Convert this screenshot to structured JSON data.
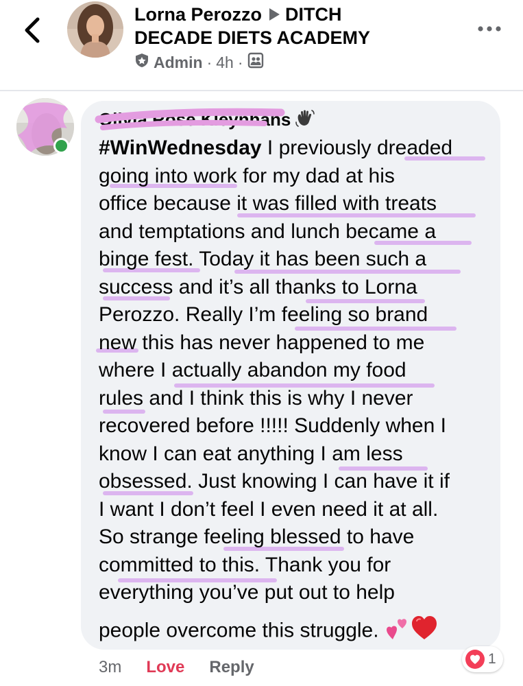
{
  "header": {
    "back_icon": "chevron-left-icon",
    "author_name": "Lorna Perozzo",
    "group_name_line1": "DITCH",
    "group_name_line2": "DECADE DIETS ACADEMY",
    "role": "Admin",
    "separator": "·",
    "time": "4h",
    "role_icon": "admin-badge-icon",
    "privacy_icon": "group-members-icon",
    "more_icon": "more-options-icon"
  },
  "comment": {
    "author_name": "Olivia Rose Kleynhans",
    "author_icon": "waving-hand-icon",
    "hashtag": "#WinWednesday",
    "lines": [
      " I previously dreaded",
      "going into work for my dad at his",
      "office because it was filled with treats",
      "and temptations and lunch became a",
      "binge fest. Today it has been such a",
      "success and it’s all thanks to Lorna",
      "Perozzo. Really I’m feeling so brand",
      "new this has never happened to me",
      "where I actually abandon my food",
      "rules and I think this is why I never",
      "recovered before !!!!! Suddenly when I",
      "know I can eat anything I am less",
      "obsessed. Just knowing I can have it if",
      "I want I don’t feel I even need it at all.",
      "So strange feeling blessed to have",
      "committed to this. Thank you for",
      "everything you’ve put out to help"
    ],
    "last_line": "people overcome this struggle.",
    "emoji": [
      "two-hearts-icon",
      "red-heart-icon"
    ],
    "highlight_color": "#d7a5ee",
    "reactions": {
      "icon": "love-reaction-icon",
      "count": "1"
    },
    "time_ago": "3m",
    "love_label": "Love",
    "reply_label": "Reply",
    "love_color": "#e03a56"
  }
}
